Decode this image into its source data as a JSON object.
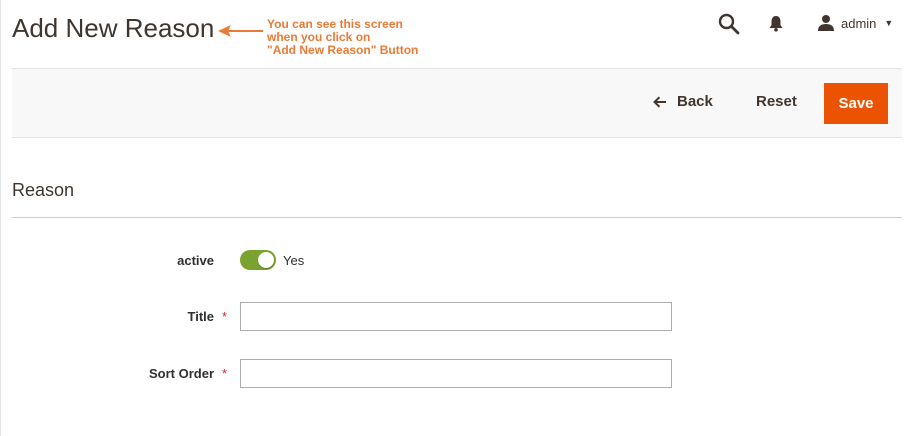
{
  "header": {
    "title": "Add New Reason",
    "annotation": {
      "line1": "You can see this screen",
      "line2": "when you click on",
      "line3": "\"Add New Reason\" Button"
    },
    "user": {
      "name": "admin"
    }
  },
  "actions": {
    "back_label": "Back",
    "reset_label": "Reset",
    "save_label": "Save"
  },
  "form": {
    "section_title": "Reason",
    "active": {
      "label": "active",
      "state_text": "Yes",
      "enabled": true
    },
    "title": {
      "label": "Title",
      "required_mark": "*",
      "value": ""
    },
    "sort_order": {
      "label": "Sort Order",
      "required_mark": "*",
      "value": ""
    }
  },
  "colors": {
    "accent": "#eb5202",
    "toggle_on": "#79a22e",
    "annotation": "#eb7a36",
    "required": "#e22626"
  }
}
